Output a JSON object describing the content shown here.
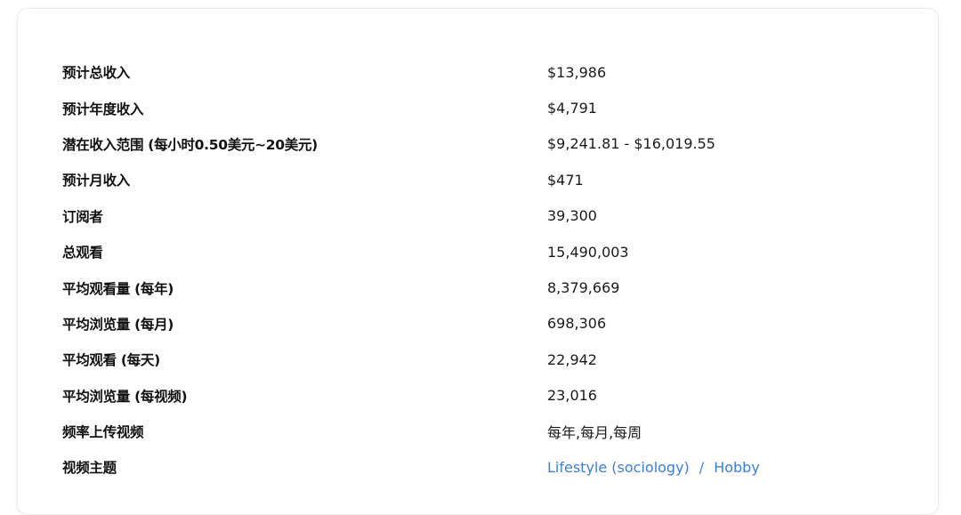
{
  "stats": [
    {
      "label": "预计总收入",
      "value": "$13,986"
    },
    {
      "label": "预计年度收入",
      "value": "$4,791"
    },
    {
      "label": "潜在收入范围 (每小时0.50美元~20美元)",
      "value": "$9,241.81 - $16,019.55"
    },
    {
      "label": "预计月收入",
      "value": "$471"
    },
    {
      "label": "订阅者",
      "value": "39,300"
    },
    {
      "label": "总观看",
      "value": "15,490,003"
    },
    {
      "label": "平均观看量 (每年)",
      "value": "8,379,669"
    },
    {
      "label": "平均浏览量 (每月)",
      "value": "698,306"
    },
    {
      "label": "平均观看 (每天)",
      "value": "22,942"
    },
    {
      "label": "平均浏览量 (每视频)",
      "value": "23,016"
    },
    {
      "label": "频率上传视频",
      "value": "每年,每月,每周"
    }
  ],
  "topics": {
    "label": "视频主题",
    "separator": "/",
    "links": [
      "Lifestyle (sociology)",
      "Hobby"
    ]
  },
  "colors": {
    "link": "#3b7fd9",
    "label_text": "#111111",
    "value_text": "#1a1a1a",
    "card_border": "#ececec"
  }
}
